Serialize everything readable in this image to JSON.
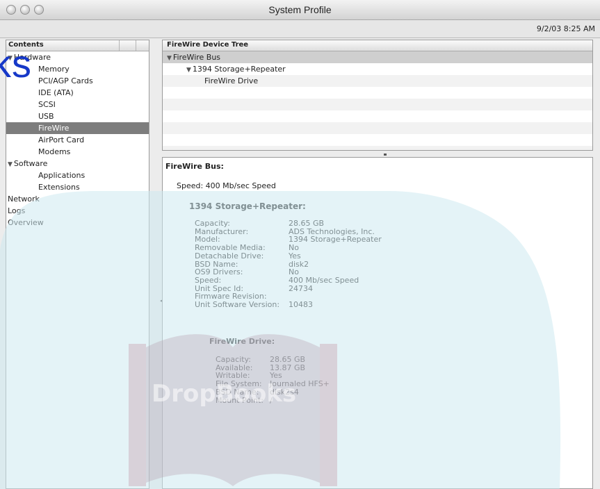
{
  "window": {
    "title": "System Profile",
    "timestamp": "9/2/03 8:25 AM"
  },
  "sidebar": {
    "header": "Contents",
    "items": [
      {
        "label": "Hardware",
        "level": 0,
        "expanded": true
      },
      {
        "label": "Memory",
        "level": 1
      },
      {
        "label": "PCI/AGP Cards",
        "level": 1
      },
      {
        "label": "IDE (ATA)",
        "level": 1
      },
      {
        "label": "SCSI",
        "level": 1
      },
      {
        "label": "USB",
        "level": 1
      },
      {
        "label": "FireWire",
        "level": 1,
        "selected": true
      },
      {
        "label": "AirPort Card",
        "level": 1
      },
      {
        "label": "Modems",
        "level": 1
      },
      {
        "label": "Software",
        "level": 0,
        "expanded": true
      },
      {
        "label": "Applications",
        "level": 1
      },
      {
        "label": "Extensions",
        "level": 1
      },
      {
        "label": "Network",
        "level": 0
      },
      {
        "label": "Logs",
        "level": 0
      },
      {
        "label": "Overview",
        "level": 0
      }
    ]
  },
  "device_tree": {
    "header": "FireWire Device Tree",
    "rows": [
      {
        "label": "FireWire Bus",
        "level": 0,
        "expanded": true,
        "selected": true
      },
      {
        "label": "1394 Storage+Repeater",
        "level": 1,
        "expanded": true
      },
      {
        "label": "FireWire Drive",
        "level": 2
      }
    ]
  },
  "details": {
    "bus_title": "FireWire Bus:",
    "bus_speed": "Speed:  400 Mb/sec Speed",
    "device_title": "1394 Storage+Repeater:",
    "device_props": [
      {
        "label": "Capacity:",
        "value": "28.65 GB"
      },
      {
        "label": "Manufacturer:",
        "value": "ADS Technologies, Inc."
      },
      {
        "label": "Model:",
        "value": "1394 Storage+Repeater"
      },
      {
        "label": "Removable Media:",
        "value": "No"
      },
      {
        "label": "Detachable Drive:",
        "value": "Yes"
      },
      {
        "label": "BSD Name:",
        "value": "disk2"
      },
      {
        "label": "OS9 Drivers:",
        "value": "No"
      },
      {
        "label": "Speed:",
        "value": "400 Mb/sec Speed"
      },
      {
        "label": "Unit Spec Id:",
        "value": "24734"
      },
      {
        "label": "Firmware Revision:",
        "value": ""
      },
      {
        "label": "Unit Software Version:",
        "value": "10483"
      }
    ],
    "drive_title": "FireWire Drive:",
    "drive_props": [
      {
        "label": "Capacity:",
        "value": "28.65 GB"
      },
      {
        "label": "Available:",
        "value": "13.87 GB"
      },
      {
        "label": "Writable:",
        "value": "Yes"
      },
      {
        "label": "File System:",
        "value": "Journaled HFS+"
      },
      {
        "label": "BSD Name:",
        "value": "disk2s4"
      },
      {
        "label": "Mount Point:",
        "value": "/"
      }
    ]
  },
  "watermark": {
    "text": "ks",
    "book_text": "DropBooks",
    "brand_color": "#1638c8",
    "wave_color": "#cdeaf0"
  }
}
